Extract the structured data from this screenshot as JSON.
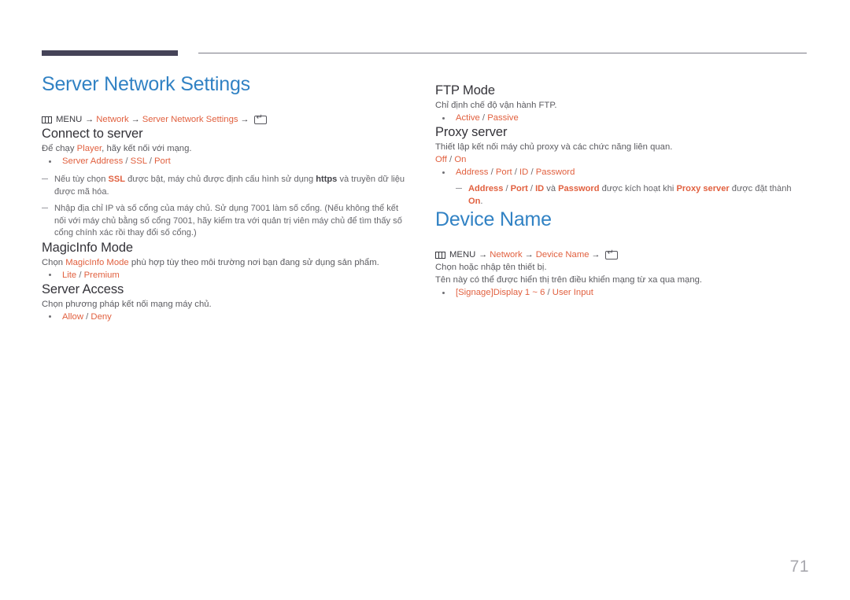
{
  "page": {
    "number": "71",
    "accent_blue": "#3182c4",
    "accent_orange": "#e1603f",
    "header_bar_color": "#454358",
    "body_text_color": "#5b5b60"
  },
  "icons": {
    "menu": "menu-icon",
    "enter": "enter-key-icon",
    "arrow": "→"
  },
  "left": {
    "chapter_title": "Server Network Settings",
    "menu_path": {
      "menu_label": "MENU",
      "step1": "Network",
      "step2": "Server Network Settings"
    },
    "connect": {
      "heading": "Connect to server",
      "desc_pre": "Để chạy ",
      "desc_hl": "Player",
      "desc_post": ", hãy kết nối với mạng.",
      "bullet": {
        "p1": "Server Address",
        "p2": "SSL",
        "p3": "Port"
      },
      "note1_a": "Nếu tùy chọn ",
      "note1_b": "SSL",
      "note1_c": " được bật, máy chủ được định cấu hình sử dụng ",
      "note1_d": "https",
      "note1_e": " và truyền dữ liệu được mã hóa.",
      "note2": "Nhập địa chỉ IP và số cổng của máy chủ. Sử dụng 7001 làm số cổng. (Nếu không thể kết nối với máy chủ bằng số cổng 7001, hãy kiểm tra với quản trị viên máy chủ để tìm thấy số cổng chính xác rồi thay đổi số cổng.)"
    },
    "magicinfo": {
      "heading": "MagicInfo Mode",
      "desc_pre": "Chọn ",
      "desc_hl": "MagicInfo Mode",
      "desc_post": " phù hợp tùy theo môi trường nơi bạn đang sử dụng sản phẩm.",
      "bullet": {
        "p1": "Lite",
        "p2": "Premium"
      }
    },
    "server_access": {
      "heading": "Server Access",
      "desc": "Chọn phương pháp kết nối mạng máy chủ.",
      "bullet": {
        "p1": "Allow",
        "p2": "Deny"
      }
    }
  },
  "right": {
    "ftp": {
      "heading": "FTP Mode",
      "desc": "Chỉ định chế độ vận hành FTP.",
      "bullet": {
        "p1": "Active",
        "p2": "Passive"
      }
    },
    "proxy": {
      "heading": "Proxy server",
      "desc": "Thiết lập kết nối máy chủ proxy và các chức năng liên quan.",
      "toggle": {
        "p1": "Off",
        "p2": "On"
      },
      "bullet": {
        "p1": "Address",
        "p2": "Port",
        "p3": "ID",
        "p4": "Password"
      },
      "note_a": "Address",
      "note_b": "Port",
      "note_c": "ID",
      "note_d": " và ",
      "note_e": "Password",
      "note_f": " được kích hoạt khi ",
      "note_g": "Proxy server",
      "note_h": " được đặt thành ",
      "note_i": "On",
      "note_j": "."
    },
    "device_name": {
      "chapter_title": "Device Name",
      "menu_path": {
        "menu_label": "MENU",
        "step1": "Network",
        "step2": "Device Name"
      },
      "line1": "Chọn hoặc nhập tên thiết bị.",
      "line2": "Tên này có thể được hiển thị trên điều khiển mạng từ xa qua mạng.",
      "bullet": {
        "p1": "[Signage]Display 1 ~ 6",
        "p2": "User Input"
      }
    }
  }
}
